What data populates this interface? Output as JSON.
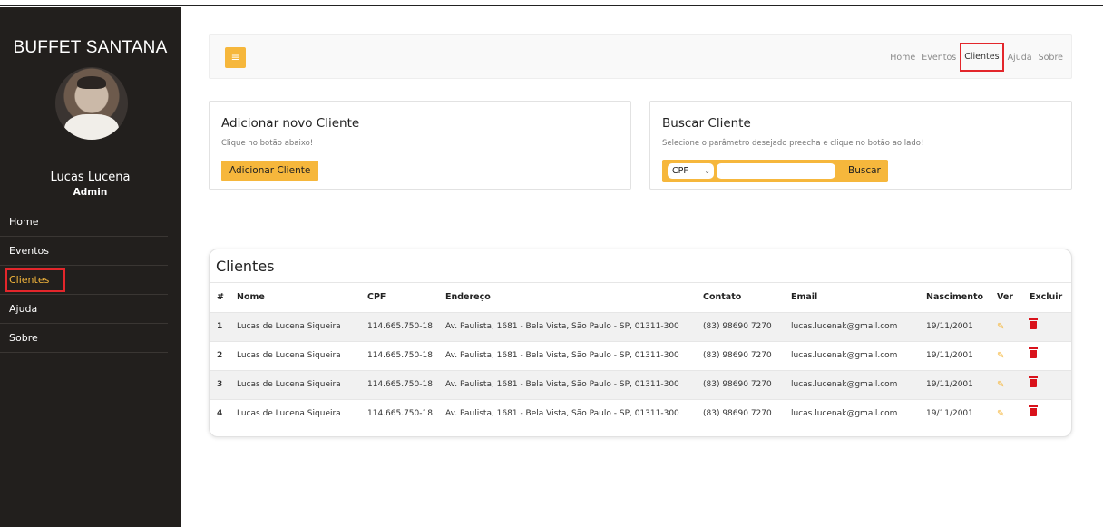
{
  "sidebar": {
    "brand": "BUFFET SANTANA",
    "user_name": "Lucas Lucena",
    "user_role": "Admin",
    "items": [
      {
        "label": "Home"
      },
      {
        "label": "Eventos"
      },
      {
        "label": "Clientes"
      },
      {
        "label": "Ajuda"
      },
      {
        "label": "Sobre"
      }
    ],
    "active_item": "Clientes"
  },
  "topbar": {
    "menu_icon": "hamburger-icon",
    "links": [
      "Home",
      "Eventos",
      "Clientes",
      "Ajuda",
      "Sobre"
    ],
    "active_link": "Clientes"
  },
  "add_card": {
    "title": "Adicionar novo Cliente",
    "hint": "Clique no botão abaixo!",
    "button": "Adicionar Cliente"
  },
  "search_card": {
    "title": "Buscar Cliente",
    "hint": "Selecione o parâmetro desejado preecha e clique no botão ao lado!",
    "select_value": "CPF",
    "input_value": "",
    "button": "Buscar"
  },
  "table": {
    "title": "Clientes",
    "columns": [
      "#",
      "Nome",
      "CPF",
      "Endereço",
      "Contato",
      "Email",
      "Nascimento",
      "Ver",
      "Excluir"
    ],
    "rows": [
      {
        "idx": "1",
        "nome": "Lucas de Lucena Siqueira",
        "cpf": "114.665.750-18",
        "endereco": "Av. Paulista, 1681 - Bela Vista, São Paulo - SP, 01311-300",
        "contato": "(83) 98690 7270",
        "email": "lucas.lucenak@gmail.com",
        "nascimento": "19/11/2001"
      },
      {
        "idx": "2",
        "nome": "Lucas de Lucena Siqueira",
        "cpf": "114.665.750-18",
        "endereco": "Av. Paulista, 1681 - Bela Vista, São Paulo - SP, 01311-300",
        "contato": "(83) 98690 7270",
        "email": "lucas.lucenak@gmail.com",
        "nascimento": "19/11/2001"
      },
      {
        "idx": "3",
        "nome": "Lucas de Lucena Siqueira",
        "cpf": "114.665.750-18",
        "endereco": "Av. Paulista, 1681 - Bela Vista, São Paulo - SP, 01311-300",
        "contato": "(83) 98690 7270",
        "email": "lucas.lucenak@gmail.com",
        "nascimento": "19/11/2001"
      },
      {
        "idx": "4",
        "nome": "Lucas de Lucena Siqueira",
        "cpf": "114.665.750-18",
        "endereco": "Av. Paulista, 1681 - Bela Vista, São Paulo - SP, 01311-300",
        "contato": "(83) 98690 7270",
        "email": "lucas.lucenak@gmail.com",
        "nascimento": "19/11/2001"
      }
    ]
  },
  "colors": {
    "accent": "#f6b73c",
    "sidebar_bg": "#221f1d",
    "highlight_border": "#e3262b",
    "delete": "#d9121b"
  }
}
